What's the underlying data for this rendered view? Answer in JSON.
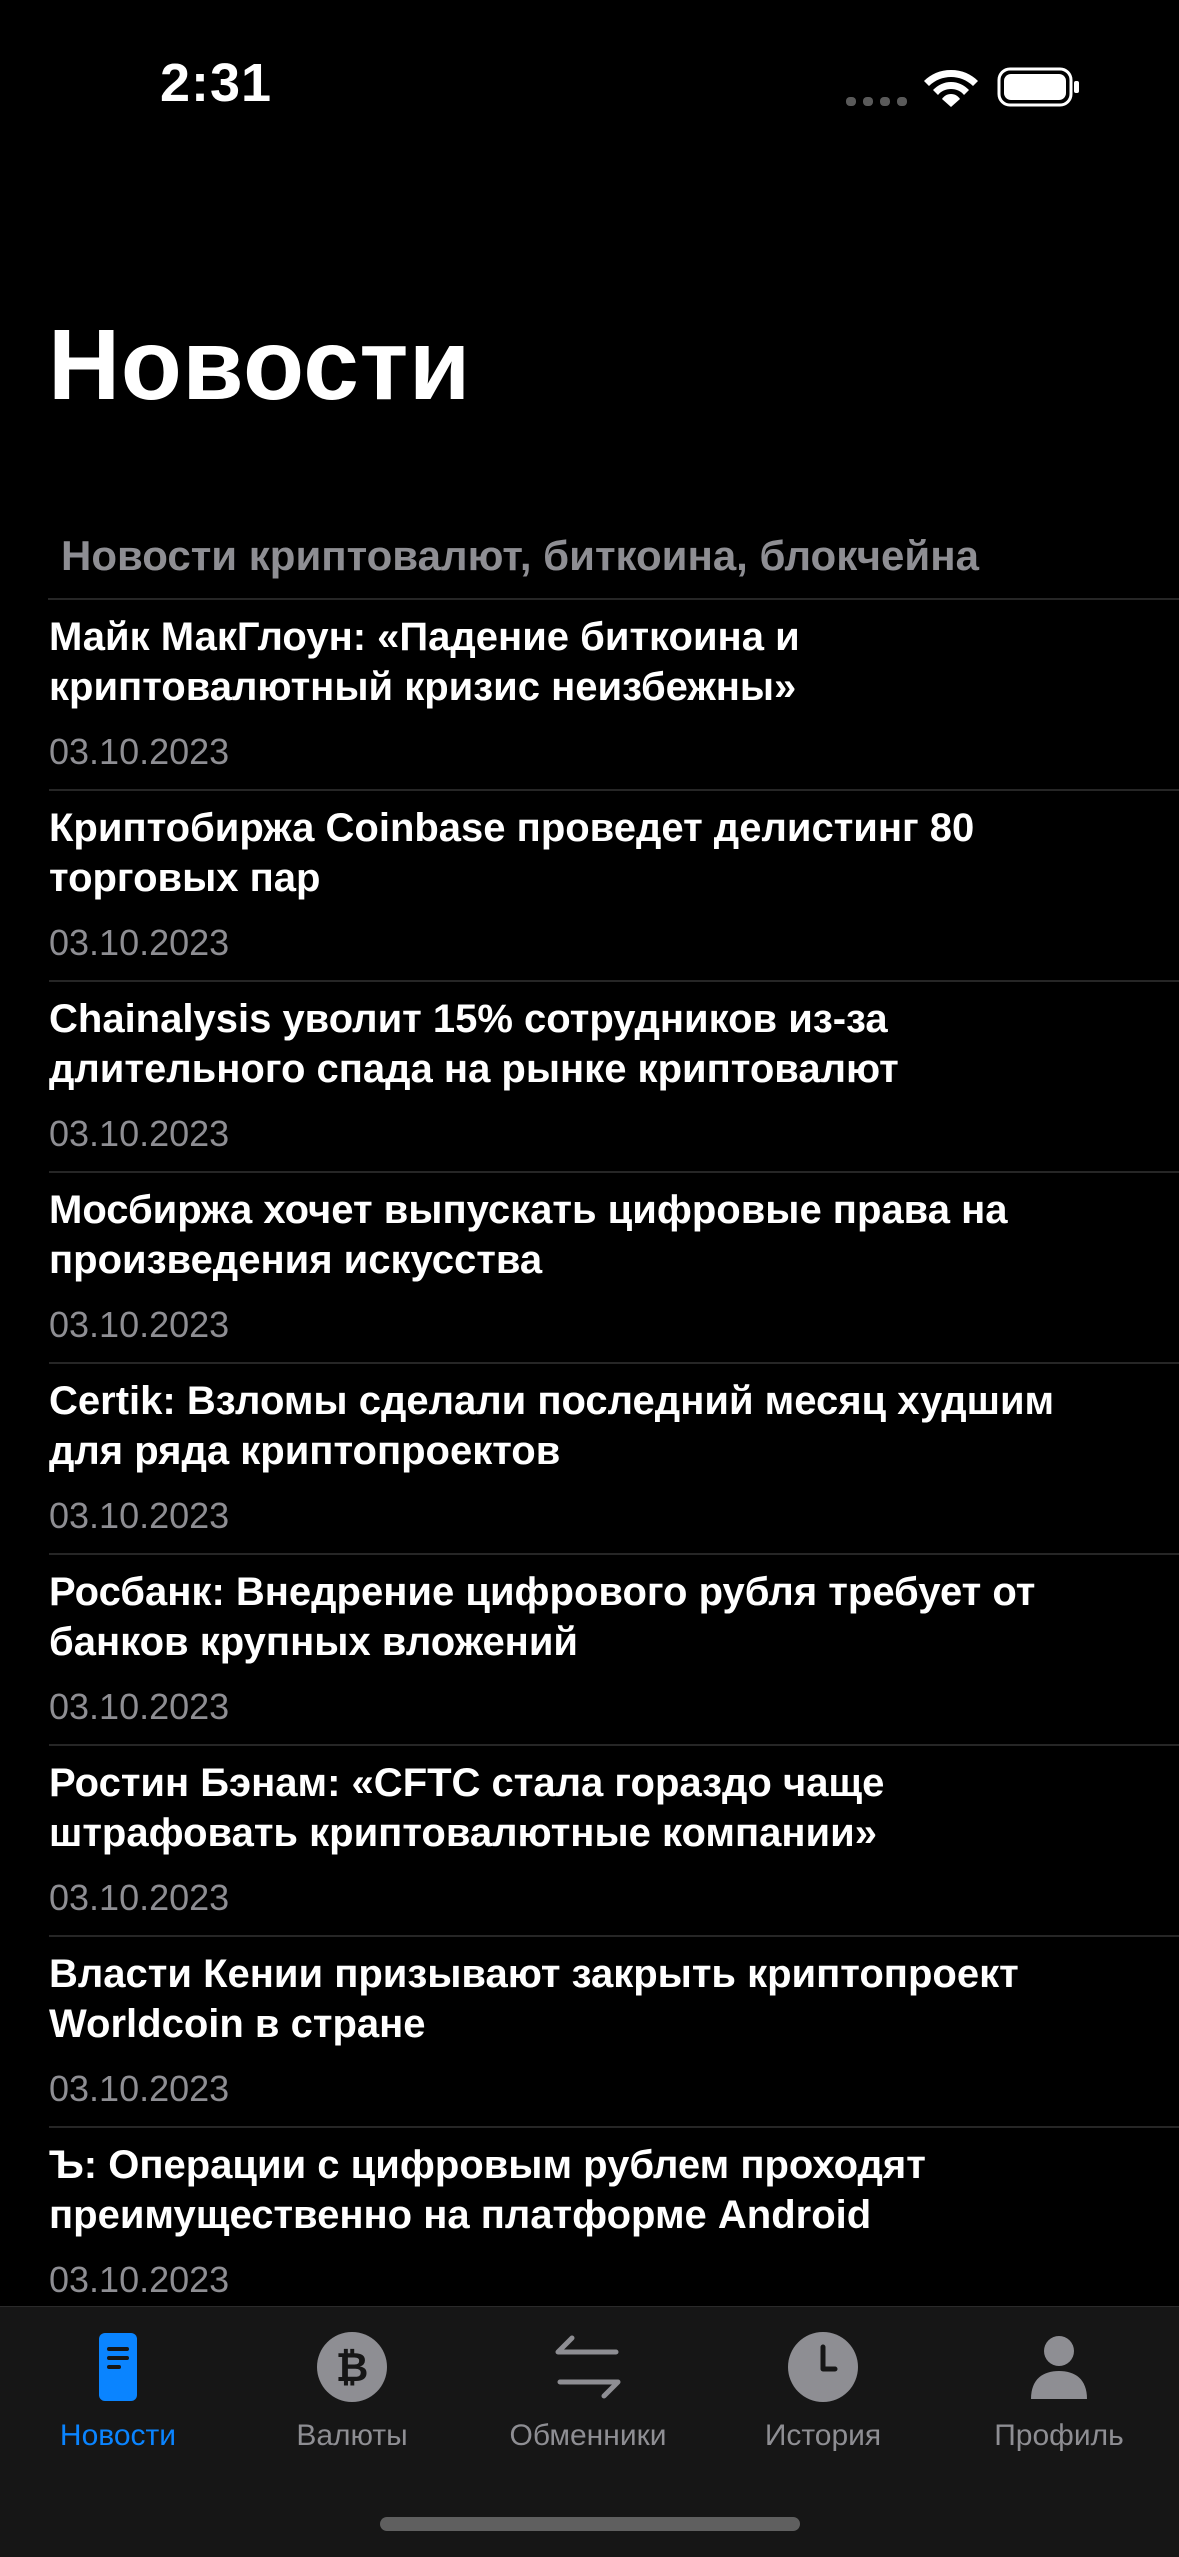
{
  "status_bar": {
    "time": "2:31"
  },
  "page": {
    "title": "Новости",
    "section_header": "Новости криптовалют, биткоина, блокчейна"
  },
  "news": [
    {
      "title": "Майк МакГлоун: «Падение биткоина и\nкриптовалютный кризис неизбежны»",
      "date": "03.10.2023"
    },
    {
      "title": "Криптобиржа Coinbase проведет делистинг 80\nторговых пар",
      "date": "03.10.2023"
    },
    {
      "title": "Chainalysis уволит 15% сотрудников из-за\nдлительного спада на рынке криптовалют",
      "date": "03.10.2023"
    },
    {
      "title": "Мосбиржа хочет выпускать цифровые права на\nпроизведения искусства",
      "date": "03.10.2023"
    },
    {
      "title": "Certik: Взломы сделали последний месяц худшим\nдля ряда криптопроектов",
      "date": "03.10.2023"
    },
    {
      "title": "Росбанк: Внедрение цифрового рубля требует от\nбанков крупных вложений",
      "date": "03.10.2023"
    },
    {
      "title": "Ростин Бэнам: «CFTC стала гораздо чаще\nштрафовать криптовалютные компании»",
      "date": "03.10.2023"
    },
    {
      "title": "Власти Кении призывают закрыть криптопроект\nWorldcoin в стране",
      "date": "03.10.2023"
    },
    {
      "title": "Ъ: Операции с цифровым рублем проходят\nпреимущественно на платформе Android",
      "date": "03.10.2023"
    }
  ],
  "tab_bar": {
    "tabs": [
      {
        "label": "Новости",
        "icon": "news-icon",
        "active": true
      },
      {
        "label": "Валюты",
        "icon": "bitcoin-icon",
        "active": false
      },
      {
        "label": "Обменники",
        "icon": "exchange-arrows-icon",
        "active": false
      },
      {
        "label": "История",
        "icon": "clock-icon",
        "active": false
      },
      {
        "label": "Профиль",
        "icon": "person-icon",
        "active": false
      }
    ]
  },
  "colors": {
    "background": "#000000",
    "accent": "#0a84ff",
    "secondary_text": "#8e8e93",
    "tab_bar": "#161616"
  }
}
